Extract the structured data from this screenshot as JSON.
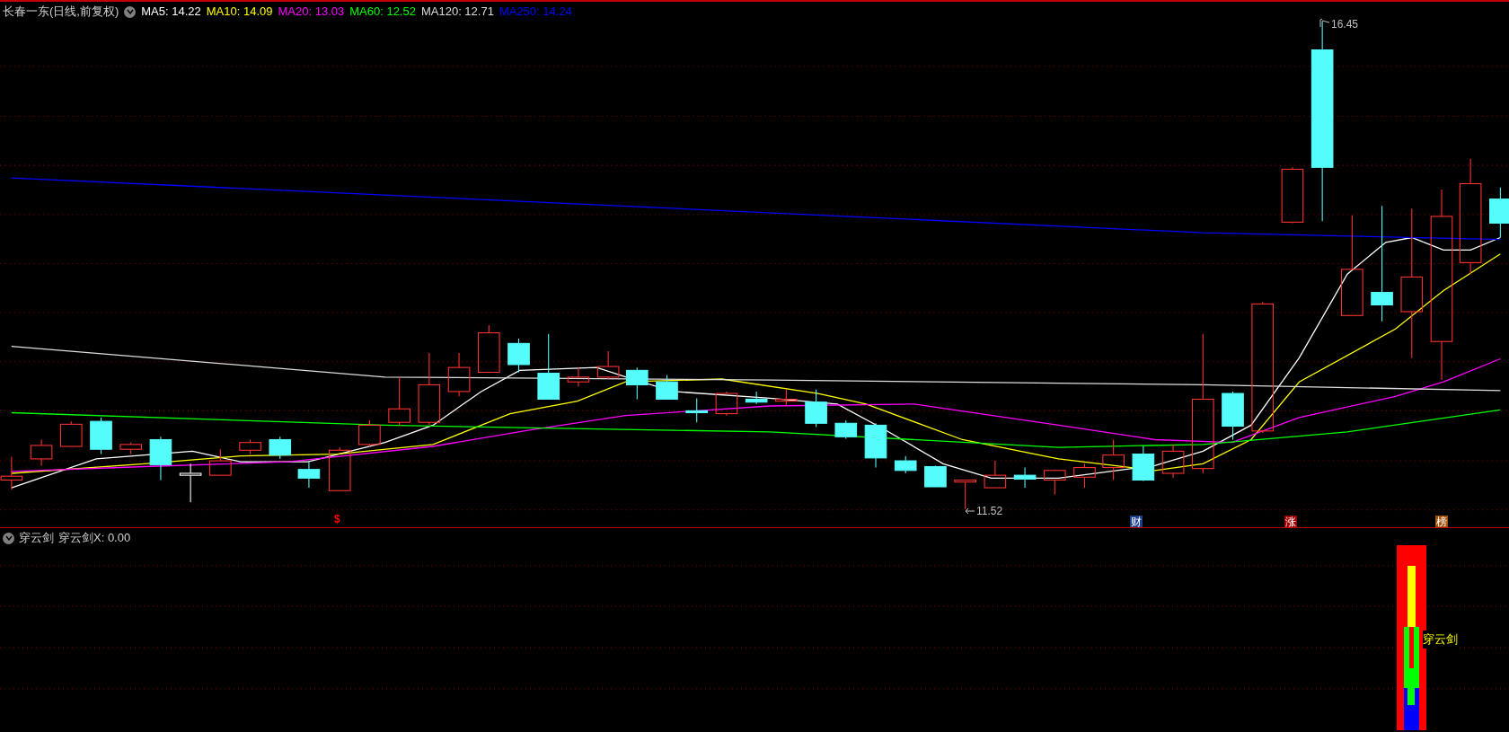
{
  "main_panel": {
    "title": "长春一东(日线,前复权)",
    "indicators": [
      {
        "label": "MA5: 14.22",
        "color": "#ffffff"
      },
      {
        "label": "MA10: 14.09",
        "color": "#ffff00"
      },
      {
        "label": "MA20: 13.03",
        "color": "#ff00ff"
      },
      {
        "label": "MA60: 12.52",
        "color": "#00ff00"
      },
      {
        "label": "MA120: 12.71",
        "color": "#dddddd"
      },
      {
        "label": "MA250: 14.24",
        "color": "#0000ff"
      }
    ],
    "annotations": [
      {
        "kind": "high",
        "text": "16.45"
      },
      {
        "kind": "low",
        "text": "11.52"
      }
    ],
    "markers": [
      {
        "kind": "arrow",
        "text": "$",
        "color": "#ff0000"
      },
      {
        "kind": "tag",
        "text": "财",
        "color": "#1c3f8c"
      },
      {
        "kind": "tag",
        "text": "涨",
        "color": "#a00000"
      },
      {
        "kind": "tag",
        "text": "榜",
        "color": "#a0520a"
      }
    ]
  },
  "sub_panel": {
    "name": "穿云剑",
    "value": "穿云剑X: 0.00",
    "signal_label": "穿云剑"
  }
}
